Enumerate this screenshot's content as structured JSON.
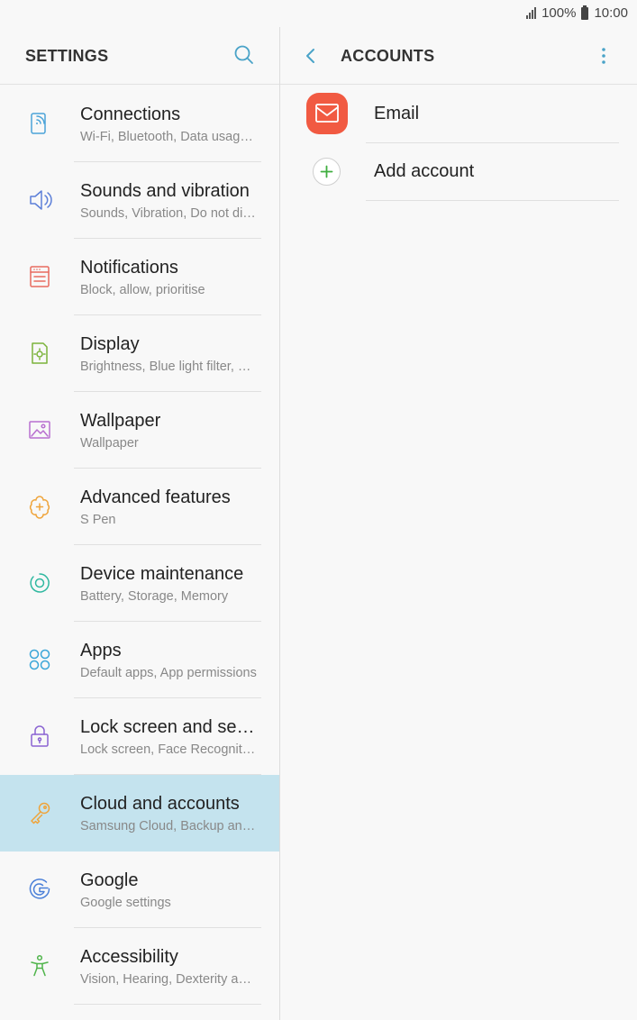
{
  "status_bar": {
    "battery_text": "100%",
    "time": "10:00"
  },
  "left": {
    "title": "SETTINGS",
    "items": [
      {
        "title": "Connections",
        "subtitle": "Wi-Fi, Bluetooth, Data usage, Flight mode",
        "icon": "connections-icon",
        "color": "#4aa3d8"
      },
      {
        "title": "Sounds and vibration",
        "subtitle": "Sounds, Vibration, Do not disturb",
        "icon": "speaker-icon",
        "color": "#5c7fd8"
      },
      {
        "title": "Notifications",
        "subtitle": "Block, allow, prioritise",
        "icon": "notifications-icon",
        "color": "#e86b5f"
      },
      {
        "title": "Display",
        "subtitle": "Brightness, Blue light filter, Home screen",
        "icon": "display-icon",
        "color": "#7bb33a"
      },
      {
        "title": "Wallpaper",
        "subtitle": "Wallpaper",
        "icon": "wallpaper-icon",
        "color": "#b86fd0"
      },
      {
        "title": "Advanced features",
        "subtitle": "S Pen",
        "icon": "advanced-features-icon",
        "color": "#efa43a"
      },
      {
        "title": "Device maintenance",
        "subtitle": "Battery, Storage, Memory",
        "icon": "device-maintenance-icon",
        "color": "#2fb8a0"
      },
      {
        "title": "Apps",
        "subtitle": "Default apps, App permissions",
        "icon": "apps-icon",
        "color": "#3aa6d8"
      },
      {
        "title": "Lock screen and security",
        "subtitle": "Lock screen, Face Recognition, Fingerprints",
        "icon": "lock-icon",
        "color": "#8a63d2"
      },
      {
        "title": "Cloud and accounts",
        "subtitle": "Samsung Cloud, Backup and restore",
        "icon": "key-icon",
        "color": "#efa43a",
        "selected": true
      },
      {
        "title": "Google",
        "subtitle": "Google settings",
        "icon": "google-icon",
        "color": "#4a7fd8"
      },
      {
        "title": "Accessibility",
        "subtitle": "Vision, Hearing, Dexterity and interaction",
        "icon": "accessibility-icon",
        "color": "#4fb44a"
      }
    ]
  },
  "right": {
    "title": "ACCOUNTS",
    "items": [
      {
        "label": "Email",
        "icon": "email-icon",
        "color": "#f15a42"
      },
      {
        "label": "Add account",
        "icon": "plus-icon",
        "color": "#3fae3f"
      }
    ]
  },
  "colors": {
    "accent": "#4aa3c8",
    "selected_bg": "#c4e3ee"
  }
}
